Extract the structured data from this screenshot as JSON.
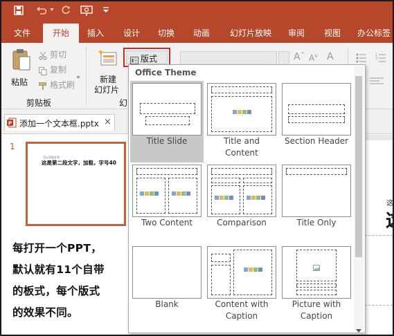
{
  "quick_access": {
    "icons": [
      "save-icon",
      "undo-icon",
      "redo-icon",
      "present-from-start-icon",
      "customize-toolbar-icon"
    ]
  },
  "tabs": [
    "文件",
    "开始",
    "插入",
    "设计",
    "切换",
    "动画",
    "幻灯片放映",
    "审阅",
    "视图",
    "办公标签"
  ],
  "active_tab": "开始",
  "ribbon": {
    "paste_label": "粘贴",
    "cut_label": "剪切",
    "copy_label": "复制",
    "format_painter_label": "格式刷",
    "clipboard_group": "剪贴板",
    "new_slide_label_1": "新建",
    "new_slide_label_2": "幻灯片",
    "slides_group_partial": "幻",
    "layout_button_label": "版式"
  },
  "document_tab": {
    "name": "添加一个文本框.pptx",
    "close": "×"
  },
  "slide_panel": {
    "slide_number": "1",
    "thumb_small_text": "可以添加文字",
    "thumb_text": "这是第二段文字，加粗，字号40"
  },
  "annotation_lines": [
    "每打开一个PPT，",
    "默认就有11个自带",
    "的板式，每个版式",
    "的效果不同。"
  ],
  "workspace": {
    "partial_small": "这",
    "partial_big": "这"
  },
  "layout_gallery": {
    "heading": "Office Theme",
    "layouts": [
      {
        "label_1": "Title Slide",
        "label_2": ""
      },
      {
        "label_1": "Title and",
        "label_2": "Content"
      },
      {
        "label_1": "Section Header",
        "label_2": ""
      },
      {
        "label_1": "Two Content",
        "label_2": ""
      },
      {
        "label_1": "Comparison",
        "label_2": ""
      },
      {
        "label_1": "Title Only",
        "label_2": ""
      },
      {
        "label_1": "Blank",
        "label_2": ""
      },
      {
        "label_1": "Content with",
        "label_2": "Caption"
      },
      {
        "label_1": "Picture with",
        "label_2": "Caption"
      }
    ],
    "selected": "Title Slide"
  },
  "colors": {
    "accent": "#b7472a",
    "highlight_box": "#e02020",
    "ribbon_bg": "#f3f2f1",
    "thumb_border": "#c5603d"
  }
}
